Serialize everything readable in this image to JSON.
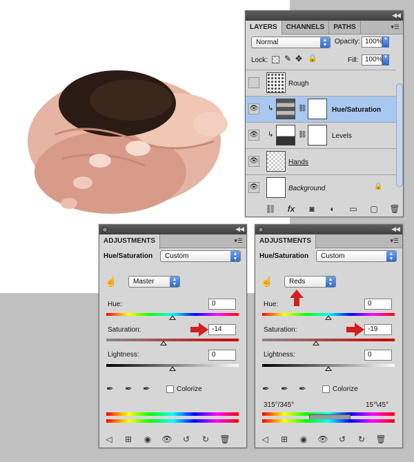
{
  "layers_panel": {
    "tabs": [
      "LAYERS",
      "CHANNELS",
      "PATHS"
    ],
    "blend_mode": "Normal",
    "opacity_label": "Opacity:",
    "opacity_value": "100%",
    "lock_label": "Lock:",
    "fill_label": "Fill:",
    "fill_value": "100%",
    "layers": [
      {
        "name": "Rough"
      },
      {
        "name": "Hue/Saturation"
      },
      {
        "name": "Levels"
      },
      {
        "name": "Hands"
      },
      {
        "name": "Background"
      }
    ],
    "bottom_icons": [
      "link-icon",
      "fx-icon",
      "mask-icon",
      "adjustment-icon",
      "group-icon",
      "new-layer-icon",
      "trash-icon"
    ]
  },
  "adjust_left": {
    "tab": "ADJUSTMENTS",
    "title": "Hue/Saturation",
    "preset": "Custom",
    "channel": "Master",
    "hue_label": "Hue:",
    "hue_value": "0",
    "saturation_label": "Saturation:",
    "saturation_value": "-14",
    "lightness_label": "Lightness:",
    "lightness_value": "0",
    "colorize_label": "Colorize"
  },
  "adjust_right": {
    "tab": "ADJUSTMENTS",
    "title": "Hue/Saturation",
    "preset": "Custom",
    "channel": "Reds",
    "hue_label": "Hue:",
    "hue_value": "0",
    "saturation_label": "Saturation:",
    "saturation_value": "-19",
    "lightness_label": "Lightness:",
    "lightness_value": "0",
    "colorize_label": "Colorize",
    "range_left": "315°/345°",
    "range_right": "15°\\45°"
  }
}
